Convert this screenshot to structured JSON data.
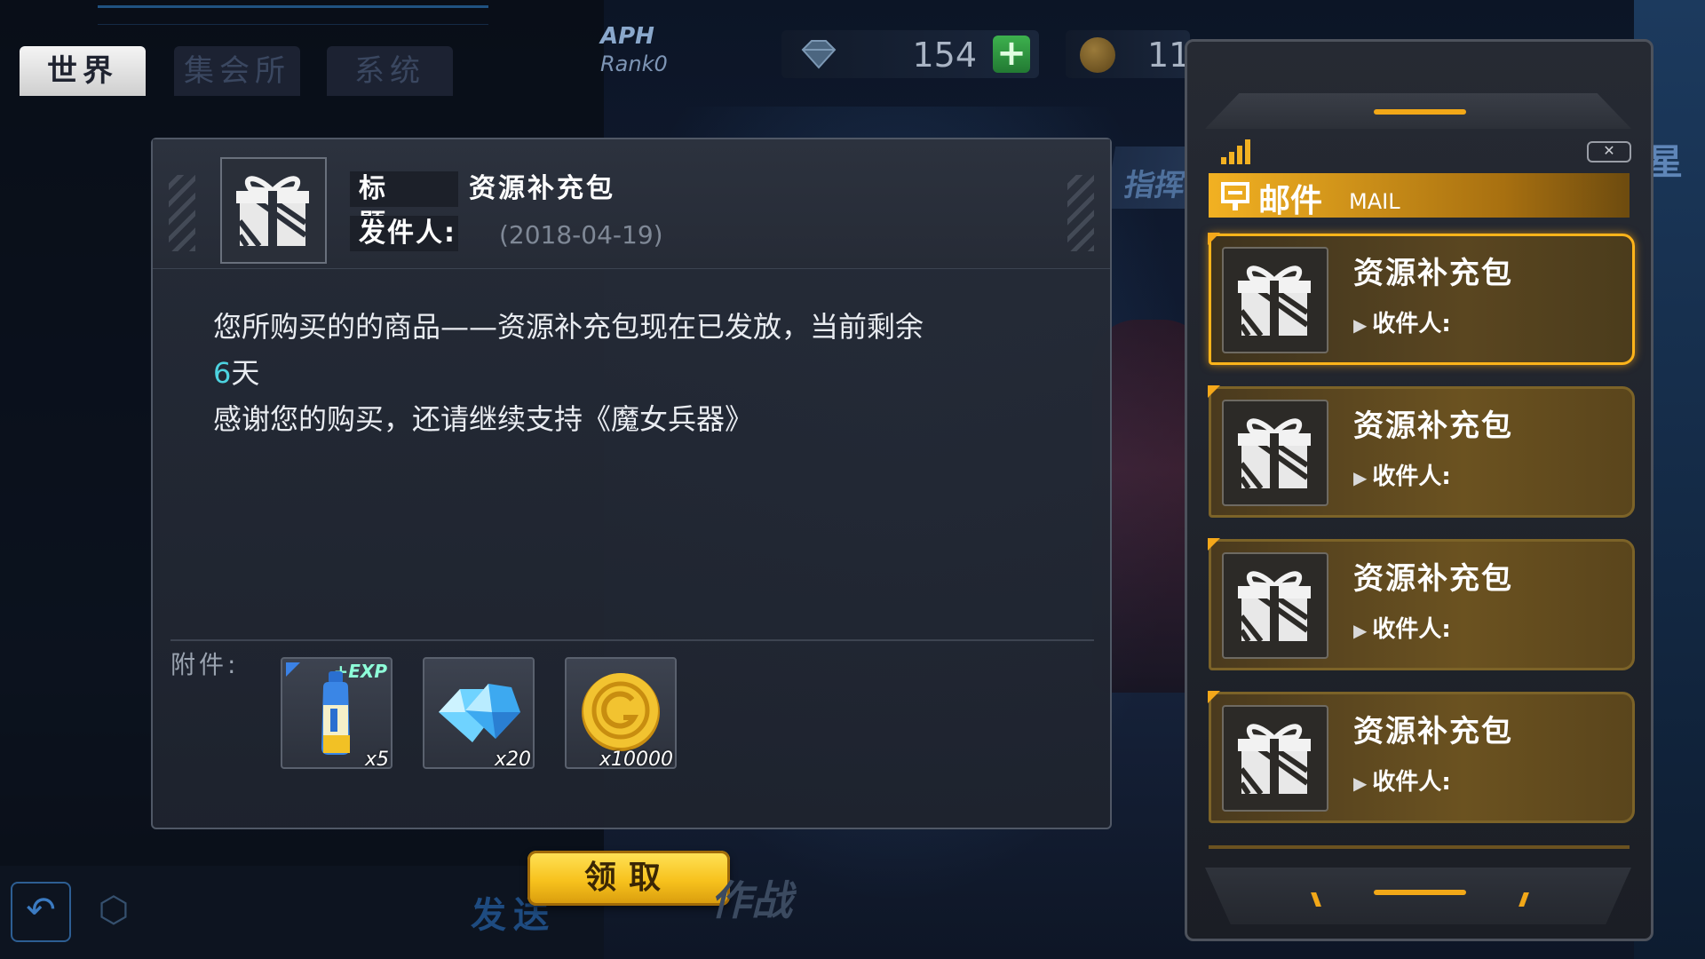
{
  "chat": {
    "tabs": [
      "世界",
      "集会所",
      "系统"
    ],
    "active_tab": 0,
    "send_label": "发送"
  },
  "resources": {
    "gems": "154",
    "gold": "11",
    "rank_title": "APH",
    "rank_sub": "Rank0"
  },
  "background": {
    "banner_text": "指挥",
    "banner_text_right": "星",
    "battle_text": "作战"
  },
  "mail_detail": {
    "title_label": "标题:",
    "title": "资源补充包",
    "sender_label": "发件人:",
    "sender": "",
    "date": "(2018-04-19)",
    "body_line1": "您所购买的的商品——资源补充包现在已发放，当前剩余",
    "days_number": "6",
    "days_unit": "天",
    "body_line3": "感谢您的购买，还请继续支持《魔女兵器》",
    "attachments_label": "附件:",
    "attachments": [
      {
        "icon": "exp-drink-icon",
        "tag": "+EXP",
        "qty": "x5"
      },
      {
        "icon": "crystal-icon",
        "qty": "x20"
      },
      {
        "icon": "gold-coin-icon",
        "qty": "x10000"
      }
    ],
    "claim_label": "领取"
  },
  "mail_list": {
    "title": "邮件",
    "title_en": "MAIL",
    "items": [
      {
        "title": "资源补充包",
        "recipient_label": "收件人:",
        "selected": true
      },
      {
        "title": "资源补充包",
        "recipient_label": "收件人:",
        "selected": false
      },
      {
        "title": "资源补充包",
        "recipient_label": "收件人:",
        "selected": false
      },
      {
        "title": "资源补充包",
        "recipient_label": "收件人:",
        "selected": false
      }
    ]
  },
  "colors": {
    "accent_gold": "#f2b122",
    "highlight_cyan": "#4dd3e0",
    "plus_green": "#3db14e"
  }
}
